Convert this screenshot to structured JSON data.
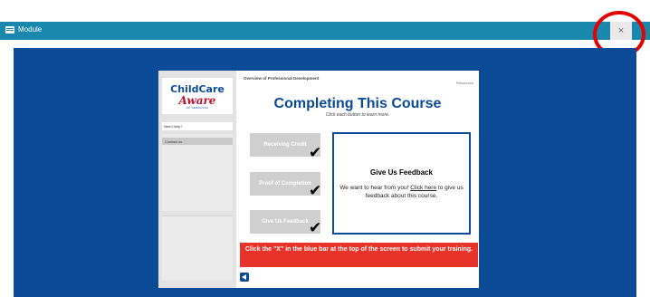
{
  "titlebar": {
    "title": "Module",
    "close_glyph": "×",
    "color": "#1a87ad"
  },
  "sidebar": {
    "logo_line1": "ChildCare",
    "logo_line2": "Aware",
    "logo_line3": "OF NEBRASKA",
    "need_help": "Need help?",
    "contact": "Contact us"
  },
  "content": {
    "breadcrumb": "Overview of Professional Development",
    "resources": "Resources",
    "title": "Completing This Course",
    "instruction": "Click each button to learn more.",
    "buttons": [
      {
        "label": "Receiving Credit"
      },
      {
        "label": "Proof of Completion"
      },
      {
        "label": "Give Us Feedback"
      }
    ],
    "panel": {
      "heading": "Give Us Feedback",
      "text_before": "We want to hear from you! ",
      "link": "Click here",
      "text_after": " to give us feedback about this course."
    },
    "banner": "Click the \"X\" in the blue bar at the top of the screen to submit your training."
  },
  "colors": {
    "stage": "#0a4a96",
    "banner": "#e8332b",
    "highlight_ring": "#e60000"
  }
}
